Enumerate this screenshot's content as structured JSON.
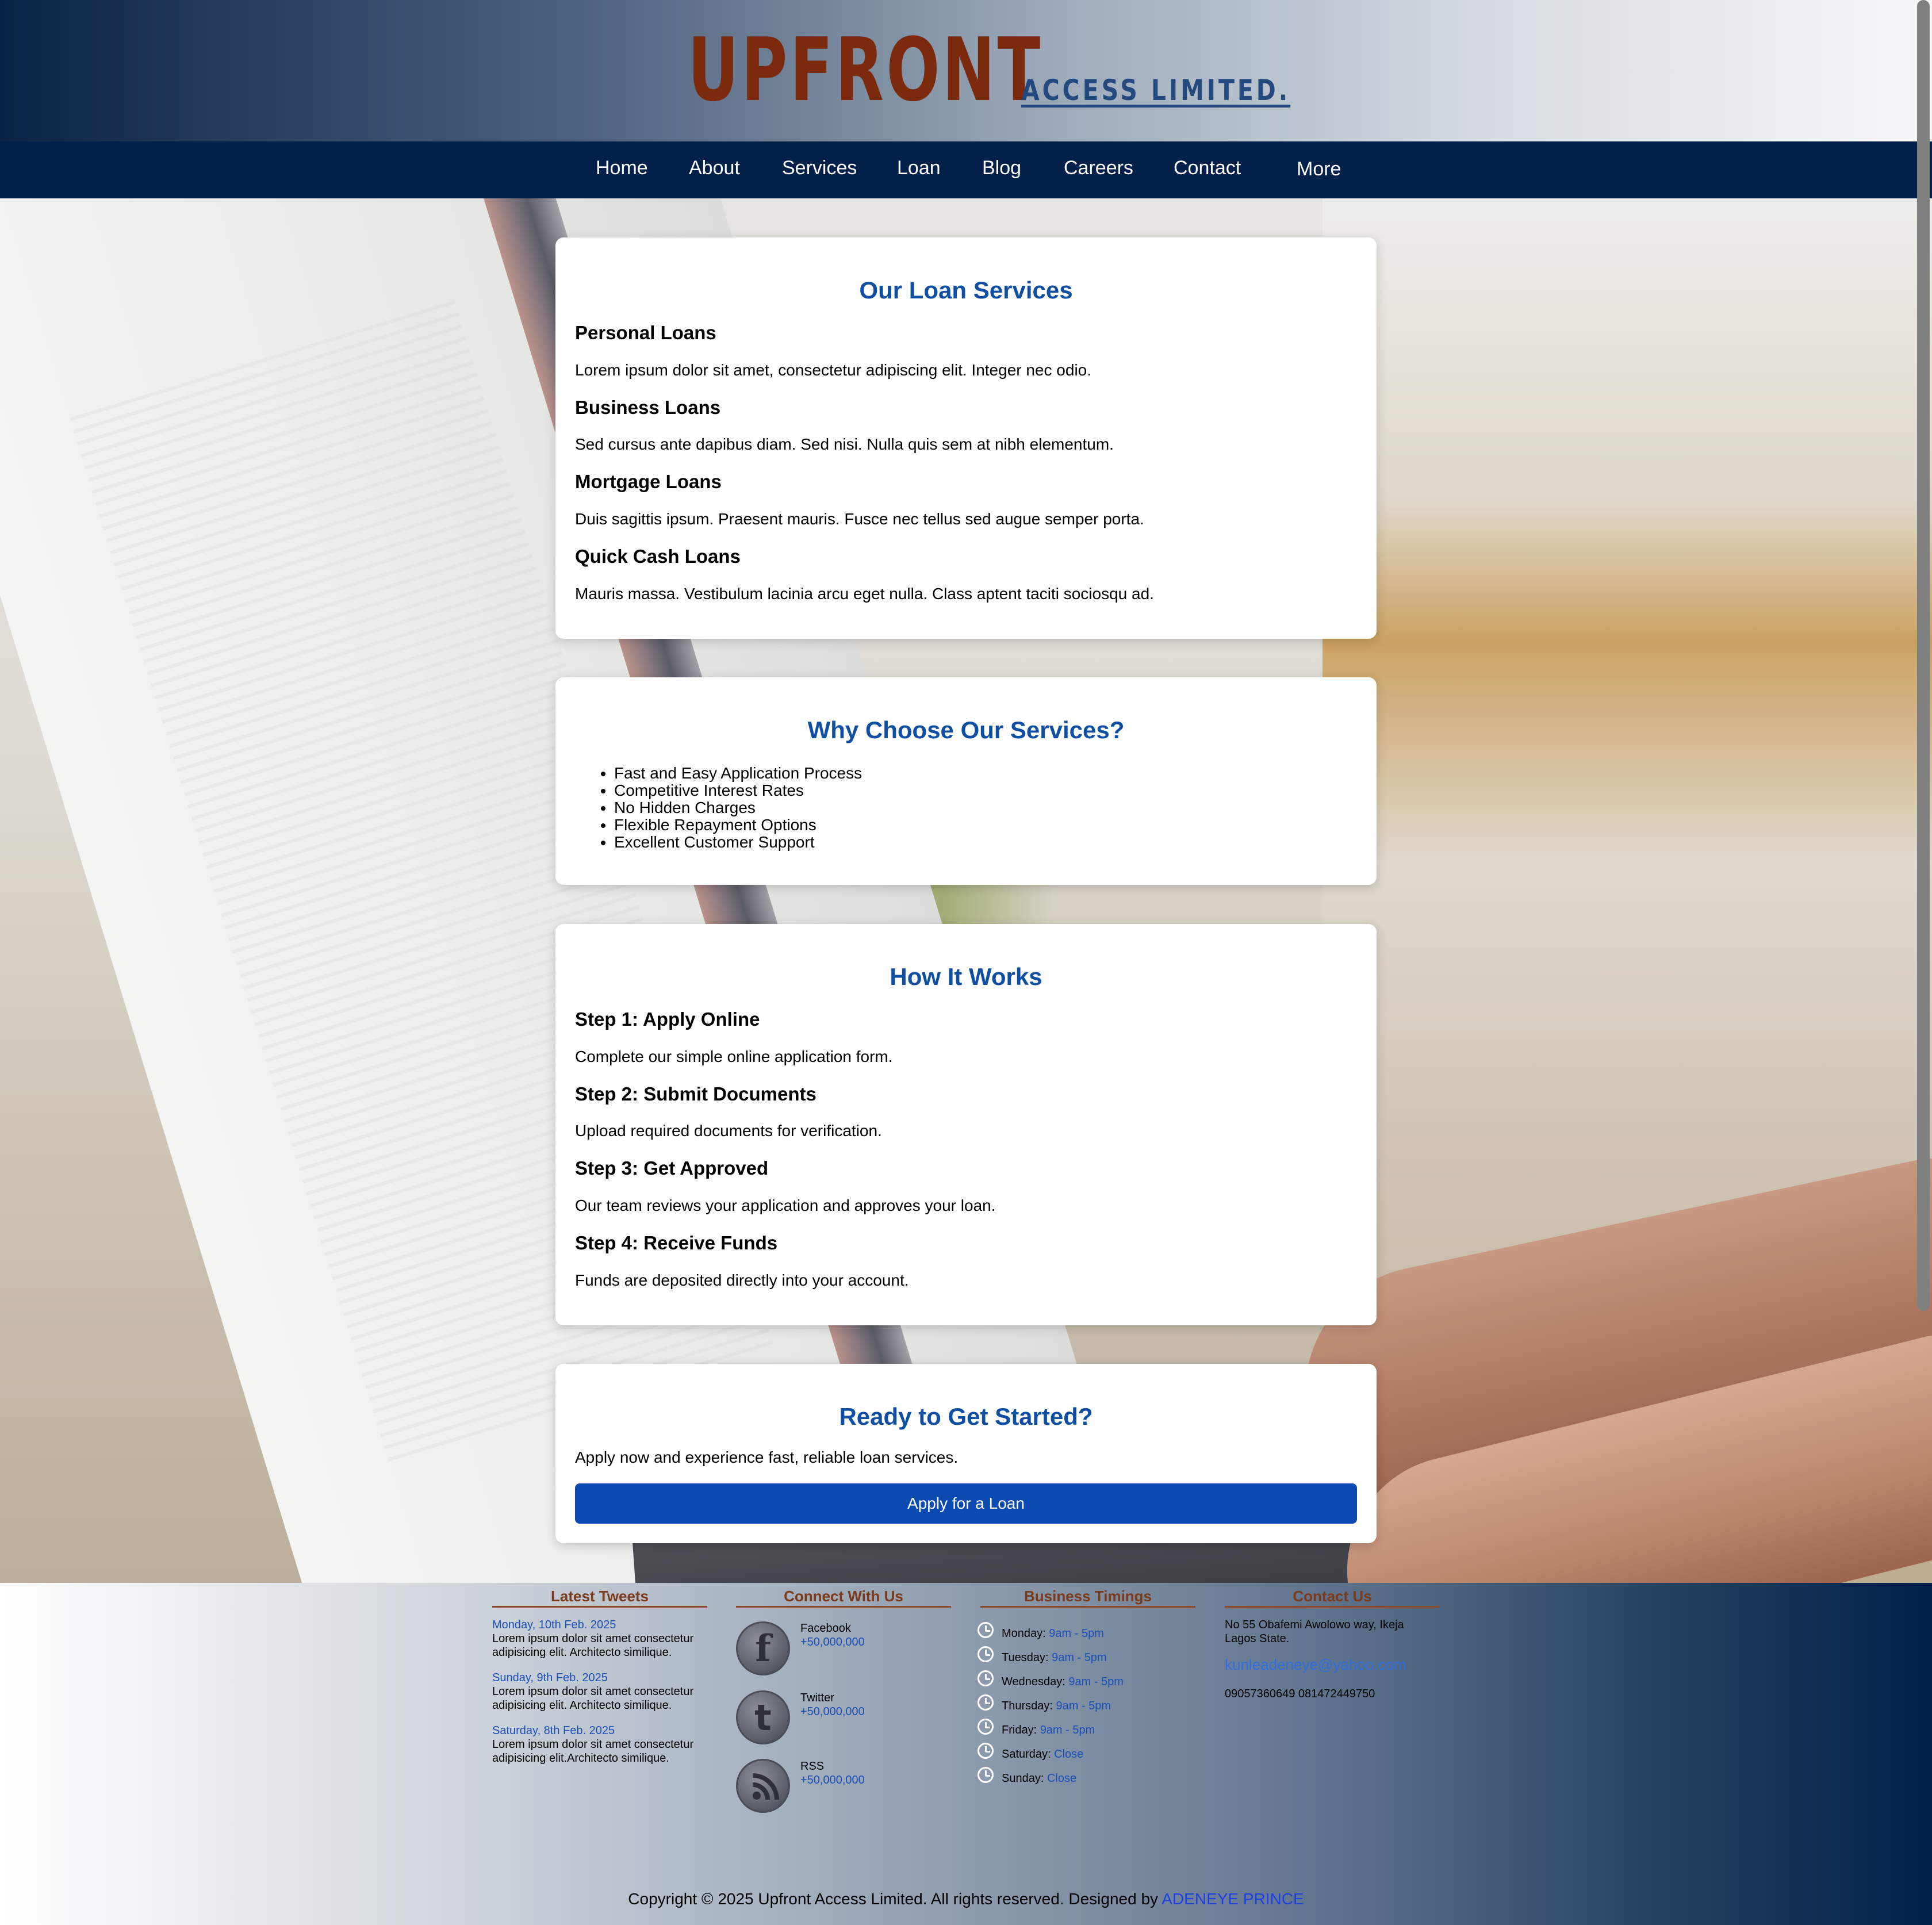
{
  "header": {
    "logo_main": "UPFRONT",
    "logo_sub": "ACCESS LIMITED.",
    "colors": {
      "logo_main": "#7b2a0e",
      "logo_sub": "#23497e",
      "nav_bg": "#03204a"
    }
  },
  "nav": {
    "items": [
      {
        "label": "Home"
      },
      {
        "label": "About"
      },
      {
        "label": "Services"
      },
      {
        "label": "Loan"
      },
      {
        "label": "Blog"
      },
      {
        "label": "Careers"
      },
      {
        "label": "Contact"
      },
      {
        "label": "More"
      }
    ]
  },
  "loan_services": {
    "title": "Our Loan Services",
    "items": [
      {
        "heading": "Personal Loans",
        "text": "Lorem ipsum dolor sit amet, consectetur adipiscing elit. Integer nec odio."
      },
      {
        "heading": "Business Loans",
        "text": "Sed cursus ante dapibus diam. Sed nisi. Nulla quis sem at nibh elementum."
      },
      {
        "heading": "Mortgage Loans",
        "text": "Duis sagittis ipsum. Praesent mauris. Fusce nec tellus sed augue semper porta."
      },
      {
        "heading": "Quick Cash Loans",
        "text": "Mauris massa. Vestibulum lacinia arcu eget nulla. Class aptent taciti sociosqu ad."
      }
    ]
  },
  "why_choose": {
    "title": "Why Choose Our Services?",
    "bullets": [
      "Fast and Easy Application Process",
      "Competitive Interest Rates",
      "No Hidden Charges",
      "Flexible Repayment Options",
      "Excellent Customer Support"
    ]
  },
  "how_it_works": {
    "title": "How It Works",
    "steps": [
      {
        "heading": "Step 1: Apply Online",
        "text": "Complete our simple online application form."
      },
      {
        "heading": "Step 2: Submit Documents",
        "text": "Upload required documents for verification."
      },
      {
        "heading": "Step 3: Get Approved",
        "text": "Our team reviews your application and approves your loan."
      },
      {
        "heading": "Step 4: Receive Funds",
        "text": "Funds are deposited directly into your account."
      }
    ]
  },
  "cta": {
    "title": "Ready to Get Started?",
    "text": "Apply now and experience fast, reliable loan services.",
    "button_label": "Apply for a Loan",
    "button_color": "#0a4ab1"
  },
  "footer": {
    "tweets": {
      "title": "Latest Tweets",
      "items": [
        {
          "date": "Monday, 10th Feb. 2025",
          "text": "Lorem ipsum dolor sit amet consectetur adipisicing elit. Architecto similique."
        },
        {
          "date": "Sunday, 9th Feb. 2025",
          "text": "Lorem ipsum dolor sit amet consectetur adipisicing elit. Architecto similique."
        },
        {
          "date": "Saturday, 8th Feb. 2025",
          "text": "Lorem ipsum dolor sit amet consectetur adipisicing elit.Architecto similique."
        }
      ]
    },
    "connect": {
      "title": "Connect With Us",
      "items": [
        {
          "name": "Facebook",
          "count": "+50,000,000",
          "icon": "facebook-icon"
        },
        {
          "name": "Twitter",
          "count": "+50,000,000",
          "icon": "twitter-icon"
        },
        {
          "name": "RSS",
          "count": "+50,000,000",
          "icon": "rss-icon"
        }
      ]
    },
    "timings": {
      "title": "Business Timings",
      "days": [
        {
          "day": "Monday:",
          "hours": "9am - 5pm"
        },
        {
          "day": "Tuesday:",
          "hours": "9am - 5pm"
        },
        {
          "day": "Wednesday:",
          "hours": "9am - 5pm"
        },
        {
          "day": "Thursday:",
          "hours": "9am - 5pm"
        },
        {
          "day": "Friday:",
          "hours": "9am - 5pm"
        },
        {
          "day": "Saturday:",
          "hours": "Close"
        },
        {
          "day": "Sunday:",
          "hours": "Close"
        }
      ]
    },
    "contact": {
      "title": "Contact Us",
      "address": "No 55 Obafemi Awolowo way, Ikeja Lagos State.",
      "email": "kunleadeneye@yahoo.com",
      "phones": "09057360649 081472449750"
    },
    "copyright": {
      "text": "Copyright © 2025 Upfront Access Limited. All rights reserved. Designed by",
      "designer": "ADENEYE PRINCE"
    }
  }
}
